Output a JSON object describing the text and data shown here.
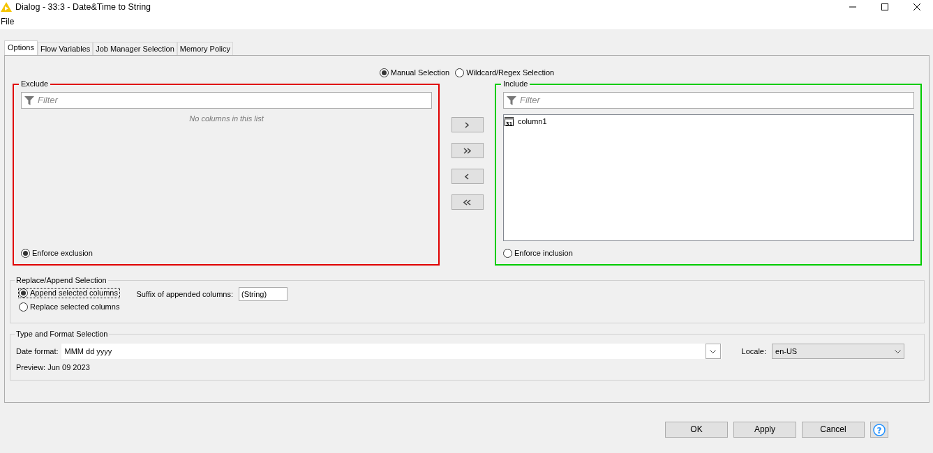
{
  "window": {
    "title": "Dialog - 33:3 - Date&Time to String"
  },
  "menu": [
    "File"
  ],
  "tabs": [
    {
      "label": "Options",
      "selected": true
    },
    {
      "label": "Flow Variables",
      "selected": false
    },
    {
      "label": "Job Manager Selection",
      "selected": false
    },
    {
      "label": "Memory Policy",
      "selected": false
    }
  ],
  "selection_modes": [
    {
      "label": "Manual Selection",
      "selected": true
    },
    {
      "label": "Wildcard/Regex Selection",
      "selected": false
    }
  ],
  "exclude": {
    "title": "Exclude",
    "color": "#e00000",
    "filter_placeholder": "Filter",
    "empty_text": "No columns in this list",
    "enforce": {
      "label": "Enforce exclusion",
      "selected": true
    }
  },
  "include": {
    "title": "Include",
    "color": "#00cc00",
    "filter_placeholder": "Filter",
    "columns": [
      {
        "name": "column1",
        "type_icon": "31"
      }
    ],
    "enforce": {
      "label": "Enforce inclusion",
      "selected": false
    }
  },
  "replace_append": {
    "title": "Replace/Append Selection",
    "options": [
      {
        "label": "Append selected columns",
        "selected": true,
        "focused": true
      },
      {
        "label": "Replace selected columns",
        "selected": false,
        "focused": false
      }
    ],
    "suffix": {
      "label": "Suffix of appended columns:",
      "value": "(String)"
    }
  },
  "type_format": {
    "title": "Type and Format Selection",
    "date_format": {
      "label": "Date format:",
      "value": "MMM dd yyyy"
    },
    "locale": {
      "label": "Locale:",
      "value": "en-US"
    },
    "preview": "Preview: Jun 09 2023"
  },
  "buttons": [
    "OK",
    "Apply",
    "Cancel"
  ],
  "help_button": "?"
}
